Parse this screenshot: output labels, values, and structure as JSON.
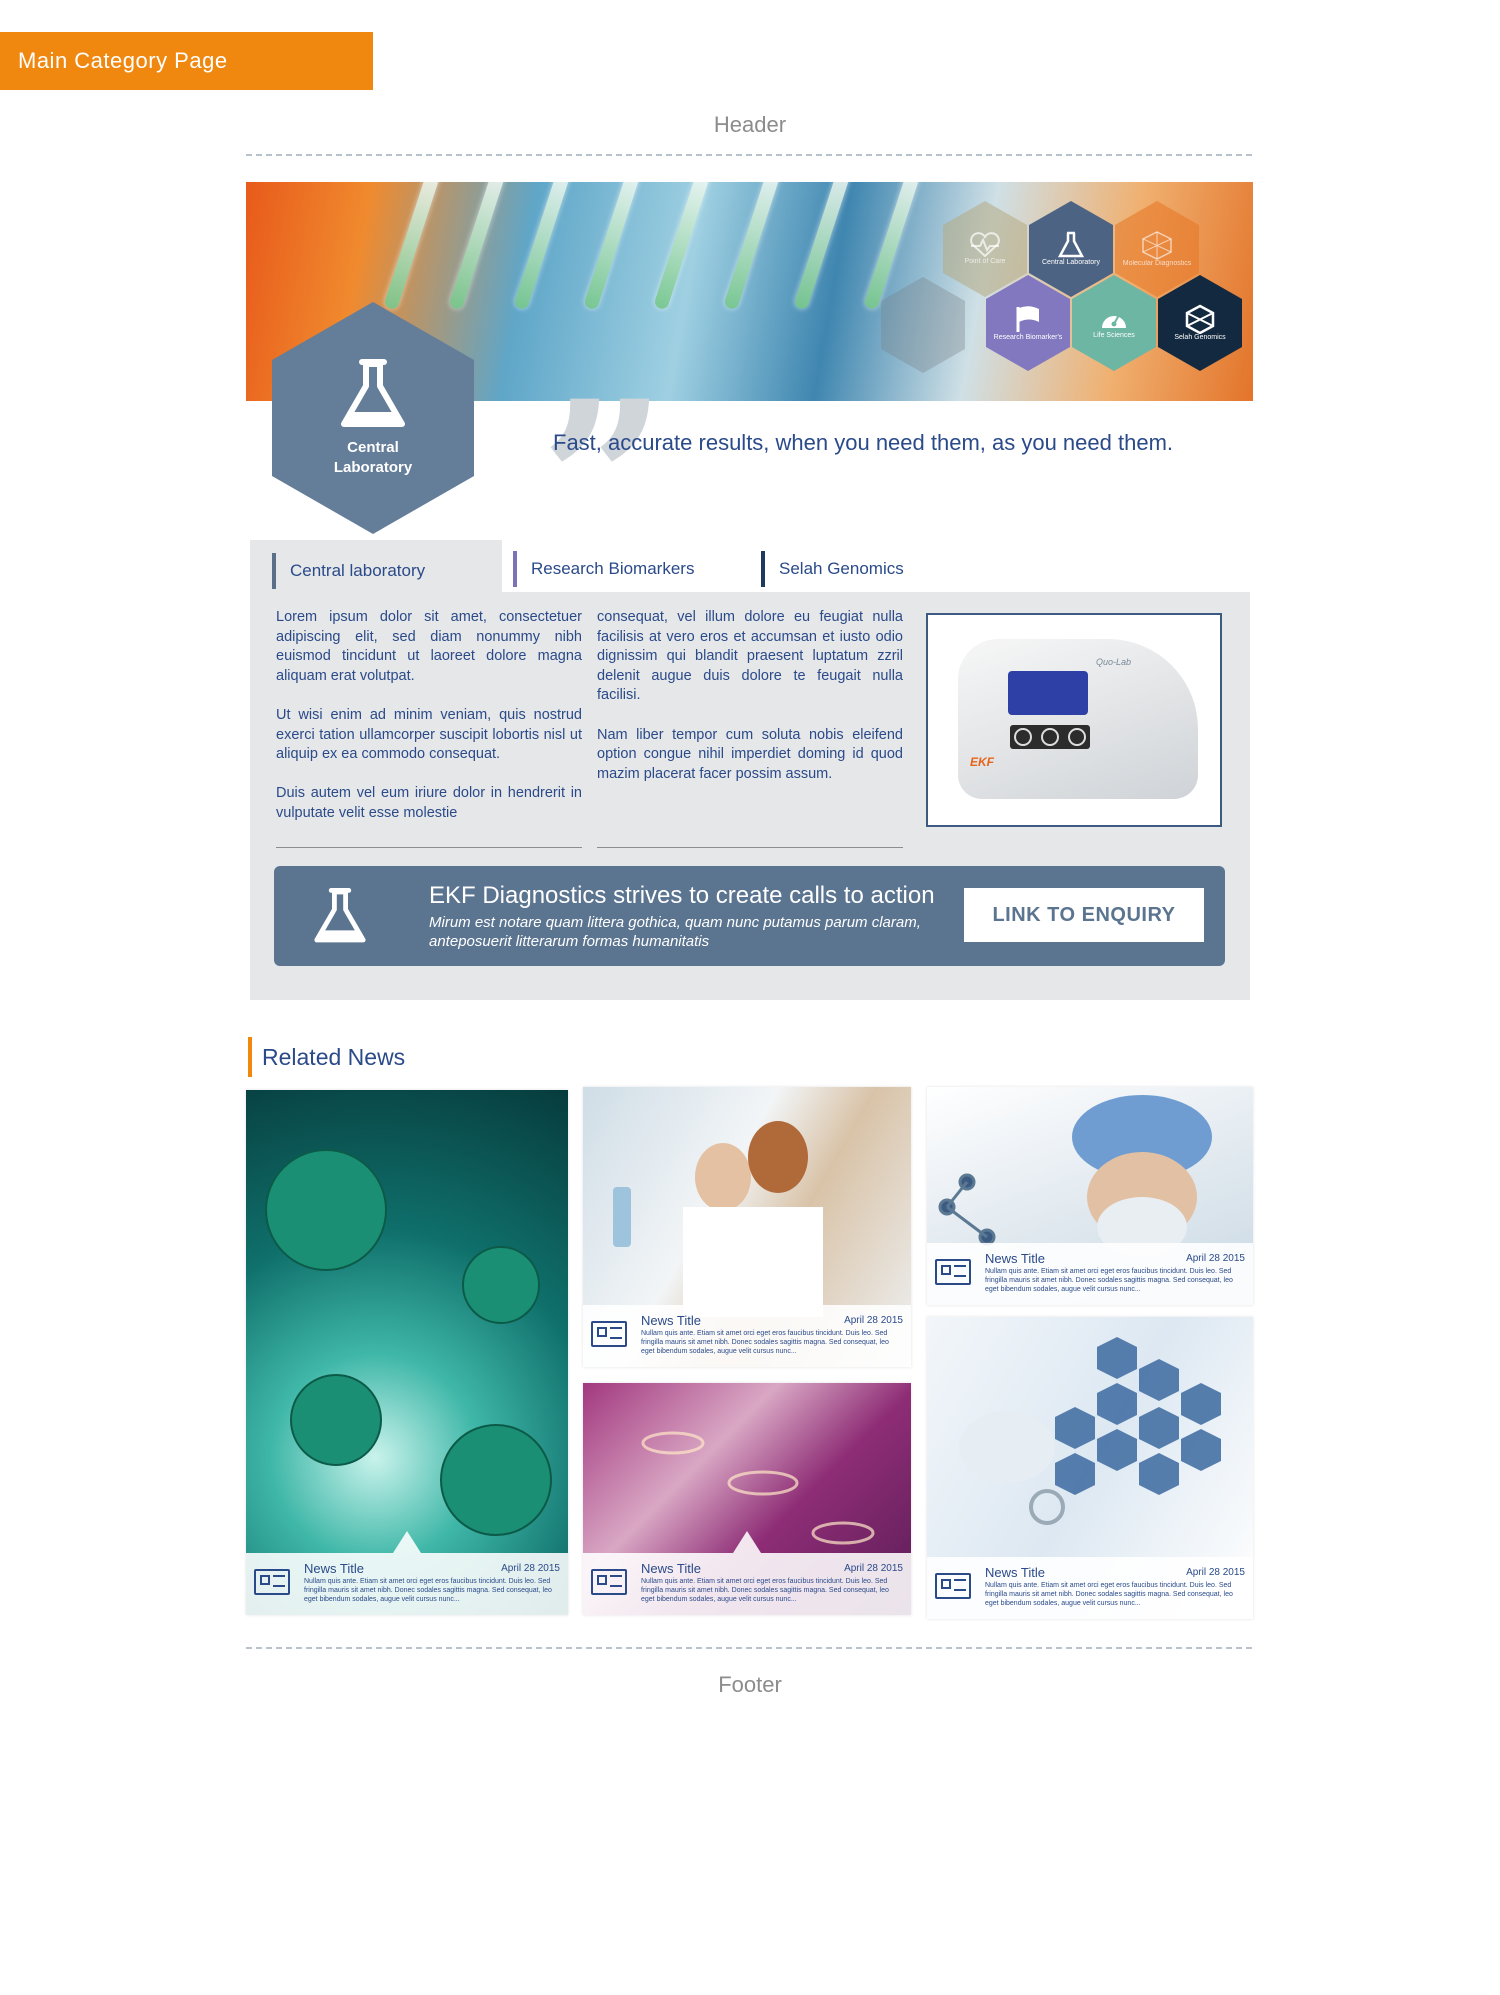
{
  "page_tag": "Main Category Page",
  "placeholders": {
    "header": "Header",
    "footer": "Footer"
  },
  "hero": {
    "hexagons": [
      {
        "label": "Point of Care",
        "icon": "heart-pulse-icon"
      },
      {
        "label": "Central Laboratory",
        "icon": "flask-icon"
      },
      {
        "label": "Molecular Diagnostics",
        "icon": "molecule-icon"
      },
      {
        "label": "Research Biomarker's",
        "icon": "flag-icon"
      },
      {
        "label": "Life Sciences",
        "icon": "gauge-icon"
      },
      {
        "label": "Selah Genomics",
        "icon": "cube-icon"
      }
    ]
  },
  "category": {
    "name_line1": "Central",
    "name_line2": "Laboratory",
    "icon": "flask-icon"
  },
  "tagline": "Fast, accurate results, when you need them, as you need them.",
  "tabs": [
    {
      "label": "Central laboratory",
      "active": true,
      "color": "#5b6f89"
    },
    {
      "label": "Research Biomarkers",
      "active": false,
      "color": "#7b72b8"
    },
    {
      "label": "Selah Genomics",
      "active": false,
      "color": "#1f3a5c"
    }
  ],
  "content": {
    "col1": [
      "Lorem ipsum dolor sit amet, consectetuer adipiscing elit, sed diam nonummy nibh euismod tincidunt ut laoreet dolore magna aliquam erat volutpat.",
      "Ut wisi enim ad minim veniam, quis nostrud exerci tation ullamcorper suscipit lobortis nisl ut aliquip ex ea commodo consequat.",
      "Duis autem vel eum iriure dolor in hendrerit in vulputate velit esse molestie"
    ],
    "col2": [
      "consequat, vel illum dolore eu feugiat nulla facilisis at vero eros et accumsan et iusto odio dignissim qui blandit praesent luptatum zzril delenit augue duis dolore te feugait nulla facilisi.",
      "Nam liber tempor cum soluta nobis eleifend option congue nihil imperdiet doming id quod mazim placerat facer possim assum."
    ],
    "product": {
      "brand": "EKF",
      "model": "Quo-Lab"
    }
  },
  "cta": {
    "title": "EKF Diagnostics strives to create calls to action",
    "subtitle": "Mirum est notare quam littera gothica, quam nunc putamus parum claram, anteposuerit litterarum formas humanitatis",
    "button": "LINK TO ENQUIRY"
  },
  "related_news": {
    "heading": "Related News",
    "items": [
      {
        "title": "News Title",
        "date": "April 28 2015",
        "text": "Nullam quis ante. Etiam sit amet orci eget eros faucibus tincidunt. Duis leo. Sed fringilla mauris sit amet nibh. Donec sodales sagittis magna. Sed consequat, leo eget bibendum sodales, augue velit cursus nunc..."
      },
      {
        "title": "News Title",
        "date": "April 28 2015",
        "text": "Nullam quis ante. Etiam sit amet orci eget eros faucibus tincidunt. Duis leo. Sed fringilla mauris sit amet nibh. Donec sodales sagittis magna. Sed consequat, leo eget bibendum sodales, augue velit cursus nunc..."
      },
      {
        "title": "News Title",
        "date": "April 28 2015",
        "text": "Nullam quis ante. Etiam sit amet orci eget eros faucibus tincidunt. Duis leo. Sed fringilla mauris sit amet nibh. Donec sodales sagittis magna. Sed consequat, leo eget bibendum sodales, augue velit cursus nunc..."
      },
      {
        "title": "News Title",
        "date": "April 28 2015",
        "text": "Nullam quis ante. Etiam sit amet orci eget eros faucibus tincidunt. Duis leo. Sed fringilla mauris sit amet nibh. Donec sodales sagittis magna. Sed consequat, leo eget bibendum sodales, augue velit cursus nunc..."
      },
      {
        "title": "News Title",
        "date": "April 28 2015",
        "text": "Nullam quis ante. Etiam sit amet orci eget eros faucibus tincidunt. Duis leo. Sed fringilla mauris sit amet nibh. Donec sodales sagittis magna. Sed consequat, leo eget bibendum sodales, augue velit cursus nunc..."
      }
    ]
  },
  "colors": {
    "accent": "#f0870f",
    "brand": "#5b7490",
    "text": "#2a4a8a"
  }
}
